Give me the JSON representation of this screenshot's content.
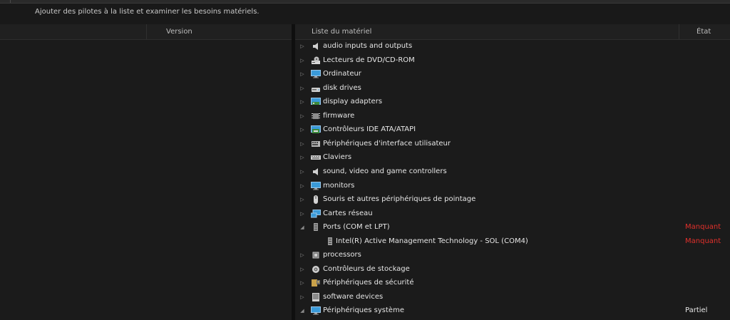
{
  "header": {
    "subtitle": "Ajouter des pilotes à la liste et examiner les besoins matériels."
  },
  "left_table": {
    "columns": {
      "version": "Version"
    }
  },
  "hardware_table": {
    "columns": {
      "hardware_list": "Liste du matériel",
      "state": "État"
    },
    "rows": [
      {
        "label": "audio inputs and outputs",
        "icon": "speaker-icon",
        "expanded": false,
        "status": ""
      },
      {
        "label": "Lecteurs de DVD/CD-ROM",
        "icon": "dvd-drive-icon",
        "expanded": false,
        "status": ""
      },
      {
        "label": "Ordinateur",
        "icon": "monitor-icon",
        "expanded": false,
        "status": ""
      },
      {
        "label": "disk drives",
        "icon": "disk-drive-icon",
        "expanded": false,
        "status": ""
      },
      {
        "label": "display adapters",
        "icon": "display-adapter-icon",
        "expanded": false,
        "status": ""
      },
      {
        "label": "firmware",
        "icon": "firmware-icon",
        "expanded": false,
        "status": ""
      },
      {
        "label": "Contrôleurs IDE ATA/ATAPI",
        "icon": "ide-controller-icon",
        "expanded": false,
        "status": ""
      },
      {
        "label": "Périphériques d'interface utilisateur",
        "icon": "hid-icon",
        "expanded": false,
        "status": ""
      },
      {
        "label": "Claviers",
        "icon": "keyboard-icon",
        "expanded": false,
        "status": ""
      },
      {
        "label": "sound, video and game controllers",
        "icon": "speaker-icon",
        "expanded": false,
        "status": ""
      },
      {
        "label": "monitors",
        "icon": "monitor-icon",
        "expanded": false,
        "status": ""
      },
      {
        "label": "Souris et autres périphériques de pointage",
        "icon": "mouse-icon",
        "expanded": false,
        "status": ""
      },
      {
        "label": "Cartes réseau",
        "icon": "network-adapter-icon",
        "expanded": false,
        "status": ""
      },
      {
        "label": "Ports (COM et LPT)",
        "icon": "port-icon",
        "expanded": true,
        "status": "Manquant",
        "status_kind": "missing"
      },
      {
        "label": "Intel(R) Active Management Technology - SOL (COM4)",
        "icon": "port-icon",
        "child": true,
        "status": "Manquant",
        "status_kind": "missing"
      },
      {
        "label": "processors",
        "icon": "processor-icon",
        "expanded": false,
        "status": ""
      },
      {
        "label": "Contrôleurs de stockage",
        "icon": "storage-controller-icon",
        "expanded": false,
        "status": ""
      },
      {
        "label": "Périphériques de sécurité",
        "icon": "security-device-icon",
        "expanded": false,
        "status": ""
      },
      {
        "label": "software devices",
        "icon": "software-device-icon",
        "expanded": false,
        "status": ""
      },
      {
        "label": "Périphériques système",
        "icon": "system-device-icon",
        "expanded": true,
        "status": "Partiel",
        "status_kind": "partial"
      }
    ]
  },
  "colors": {
    "background": "#191919",
    "missing": "#e0302b",
    "icon_blue": "#3a9ad9"
  }
}
